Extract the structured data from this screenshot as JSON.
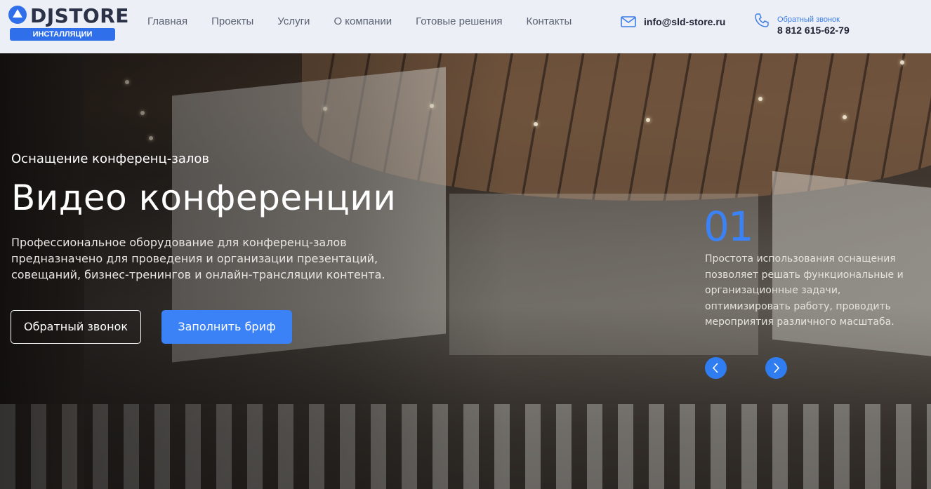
{
  "brand": {
    "name": "DJSTORE",
    "tagline": "ИНСТАЛЛЯЦИИ",
    "accent": "#2f6fea"
  },
  "nav": {
    "items": [
      {
        "label": "Главная"
      },
      {
        "label": "Проекты"
      },
      {
        "label": "Услуги"
      },
      {
        "label": "О компании"
      },
      {
        "label": "Готовые решения"
      },
      {
        "label": "Контакты"
      }
    ]
  },
  "contacts": {
    "email": "info@sld-store.ru",
    "email_icon": "mail-icon",
    "callback_label": "Обратный звонок",
    "phone": "8 812 615-62-79",
    "phone_icon": "phone-icon"
  },
  "hero": {
    "subtitle": "Оснащение конференц-залов",
    "title": "Видео конференции",
    "description": "Профессиональное оборудование для конференц-залов предназначено для проведения и организации презентаций, совещаний, бизнес-тренингов и онлайн-трансляции контента.",
    "buttons": {
      "callback": "Обратный звонок",
      "brief": "Заполнить бриф"
    },
    "primary_color": "#3b82f6"
  },
  "slider": {
    "number": "01",
    "text": "Простота использования оснащения позволяет решать функциональные и организационные задачи, оптимизировать работу, проводить мероприятия различного масштаба.",
    "prev_icon": "chevron-left-icon",
    "next_icon": "chevron-right-icon"
  }
}
